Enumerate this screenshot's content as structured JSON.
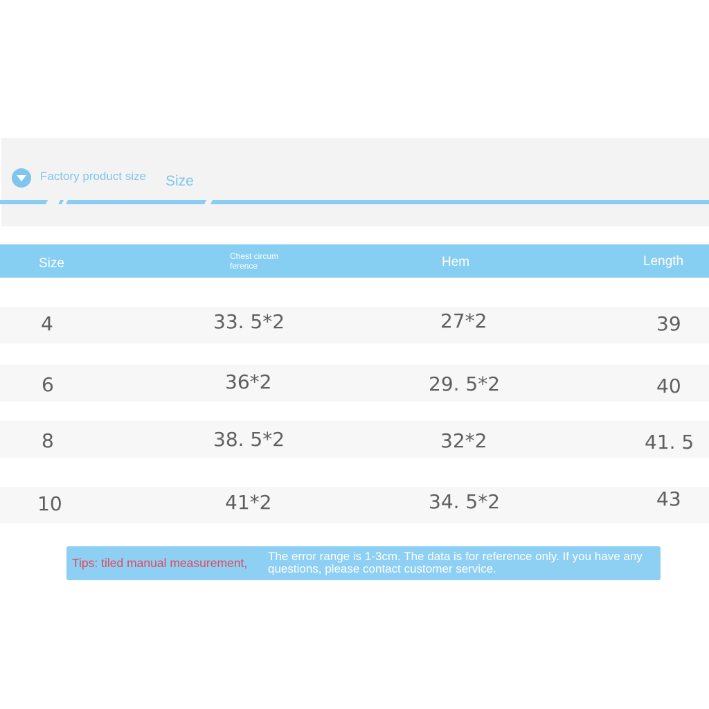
{
  "header": {
    "subtitle": "Factory product size",
    "title": "Size"
  },
  "table": {
    "columns": [
      "Size",
      "Chest circumference",
      "Hem",
      "Length"
    ],
    "rows": [
      [
        "4",
        "33. 5*2",
        "27*2",
        "39"
      ],
      [
        "6",
        "36*2",
        "29. 5*2",
        "40"
      ],
      [
        "8",
        "38. 5*2",
        "32*2",
        "41. 5"
      ],
      [
        "10",
        "41*2",
        "34. 5*2",
        "43"
      ]
    ]
  },
  "tips": {
    "label": "Tips: tiled manual measurement,",
    "text": "The error range is 1-3cm. The data is for reference only. If you have any questions, please contact customer service."
  },
  "colors": {
    "accent": "#87cef3",
    "tip_label": "#e0485c",
    "row_background": "#f7f7f7",
    "value_text": "#5f5f5f"
  },
  "icons": {
    "header": "chevron-down-circle-icon"
  }
}
